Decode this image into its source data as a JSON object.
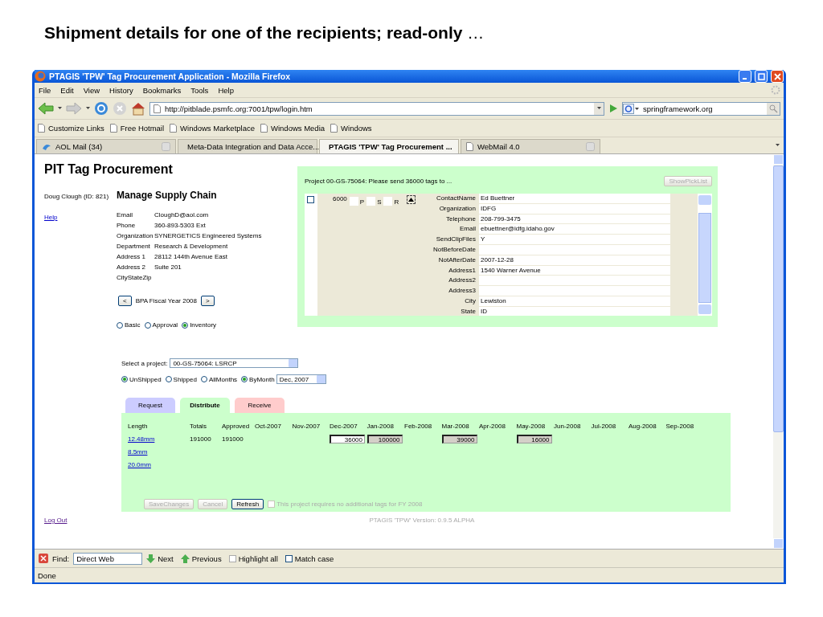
{
  "caption": {
    "text": "**Shipment details for one of the recipients; read-only** …"
  },
  "window": {
    "title": "PTAGIS 'TPW' Tag Procurement Application - Mozilla Firefox"
  },
  "menu": [
    "File",
    "Edit",
    "View",
    "History",
    "Bookmarks",
    "Tools",
    "Help"
  ],
  "address_bar": {
    "value": "http://pitblade.psmfc.org:7001/tpw/login.htm"
  },
  "search_bar": {
    "value": "springframework.org"
  },
  "bookmarks": [
    "Customize Links",
    "Free Hotmail",
    "Windows Marketplace",
    "Windows Media",
    "Windows"
  ],
  "browser_tabs": [
    {
      "label": "AOL Mail (34)",
      "selected": false
    },
    {
      "label": "Meta-Data Integration and Data Acce...",
      "selected": false
    },
    {
      "label": "PTAGIS 'TPW' Tag Procurement ...",
      "selected": true
    },
    {
      "label": "WebMail 4.0",
      "selected": false
    }
  ],
  "page": {
    "title": "PIT Tag Procurement",
    "user": "Doug Clough (ID: 821)",
    "help": "Help",
    "heading": "Manage Supply Chain",
    "profile": [
      {
        "label": "Email",
        "value": "CloughD@aol.com"
      },
      {
        "label": "Phone",
        "value": "360-893-5303 Ext"
      },
      {
        "label": "Organization",
        "value": "SYNERGETICS Engineered Systems"
      },
      {
        "label": "Department",
        "value": "Research & Development"
      },
      {
        "label": "Address 1",
        "value": "28112 144th Avenue East"
      },
      {
        "label": "Address 2",
        "value": "Suite 201"
      },
      {
        "label": "CityStateZip"
      }
    ],
    "fiscal_year": {
      "prev": "<",
      "label": "BPA Fiscal Year 2008",
      "next": ">"
    },
    "view_modes": [
      {
        "label": "Basic",
        "selected": false
      },
      {
        "label": "Approval",
        "selected": false
      },
      {
        "label": "Inventory",
        "selected": true
      }
    ],
    "project_select": {
      "label": "Select a project:",
      "value": "00-GS-75064: LSRCP"
    },
    "shipment_filter": [
      {
        "label": "UnShipped",
        "selected": true
      },
      {
        "label": "Shipped",
        "selected": false
      }
    ],
    "month_filter": [
      {
        "label": "AllMonths",
        "selected": false
      },
      {
        "label": "ByMonth",
        "selected": true
      }
    ],
    "month_select": {
      "value": "Dec, 2007"
    },
    "picklist": {
      "title": "Project 00-GS-75064: Please send 36000 tags to ...",
      "button": {
        "label": "ShowPickList",
        "disabled": true
      },
      "entry": {
        "checked": false,
        "count": "6000",
        "flags": [
          {
            "label": "P",
            "checked": false
          },
          {
            "label": "S",
            "checked": false
          },
          {
            "label": "R",
            "checked": false
          }
        ]
      },
      "fields": [
        {
          "label": "ContactName",
          "value": "Ed Buettner"
        },
        {
          "label": "Organization",
          "value": "IDFG"
        },
        {
          "label": "Telephone",
          "value": "208-799-3475"
        },
        {
          "label": "Email",
          "value": "ebuettner@idfg.idaho.gov"
        },
        {
          "label": "SendClipFiles",
          "value": "Y"
        },
        {
          "label": "NotBeforeDate"
        },
        {
          "label": "NotAfterDate",
          "value": "2007-12-28"
        },
        {
          "label": "Address1",
          "value": "1540 Warner Avenue"
        },
        {
          "label": "Address2"
        },
        {
          "label": "Address3"
        },
        {
          "label": "City",
          "value": "Lewiston"
        },
        {
          "label": "State",
          "value": "ID"
        }
      ]
    },
    "tabs": [
      {
        "label": "Request",
        "selected": false,
        "color": "#ccccff"
      },
      {
        "label": "Distribute",
        "selected": true,
        "color": "#ccffcc"
      },
      {
        "label": "Receive",
        "selected": false,
        "color": "#ffcccc"
      }
    ],
    "distribution": {
      "columns": [
        "Length",
        "Totals",
        "Approved",
        "Oct-2007",
        "Nov-2007",
        "Dec-2007",
        "Jan-2008",
        "Feb-2008",
        "Mar-2008",
        "Apr-2008",
        "May-2008",
        "Jun-2008",
        "Jul-2008",
        "Aug-2008",
        "Sep-2008"
      ],
      "rows": [
        {
          "length": "12.48mm",
          "totals": "191000",
          "approved": "191000",
          "months": [
            {
              "kind": "empty"
            },
            {
              "kind": "empty"
            },
            {
              "kind": "field",
              "value": "36000",
              "editable": true
            },
            {
              "kind": "field",
              "value": "100000",
              "editable": false
            },
            {
              "kind": "empty"
            },
            {
              "kind": "field",
              "value": "39000",
              "editable": false
            },
            {
              "kind": "empty"
            },
            {
              "kind": "field",
              "value": "16000",
              "editable": false
            },
            {
              "kind": "empty"
            },
            {
              "kind": "empty"
            },
            {
              "kind": "empty"
            },
            {
              "kind": "empty"
            }
          ]
        },
        {
          "length": "8.5mm"
        },
        {
          "length": "20.0mm"
        }
      ]
    },
    "buttons": [
      {
        "label": "SaveChanges",
        "disabled": true
      },
      {
        "label": "Cancel",
        "disabled": true
      },
      {
        "label": "Refresh",
        "disabled": false
      }
    ],
    "no_tags": {
      "label": "This project requires no additional tags for FY 2008",
      "checked": false,
      "disabled": true
    },
    "logout": "Log Out",
    "version": "PTAGIS 'TPW' Version: 0.9.5 ALPHA"
  },
  "find_bar": {
    "label": "Find:",
    "value": "Direct Web",
    "next": "Next",
    "previous": "Previous",
    "highlight": {
      "label": "Highlight all",
      "checked": false
    },
    "match_case": {
      "label": "Match case",
      "checked": false
    }
  },
  "status_bar": {
    "text": "Done"
  }
}
